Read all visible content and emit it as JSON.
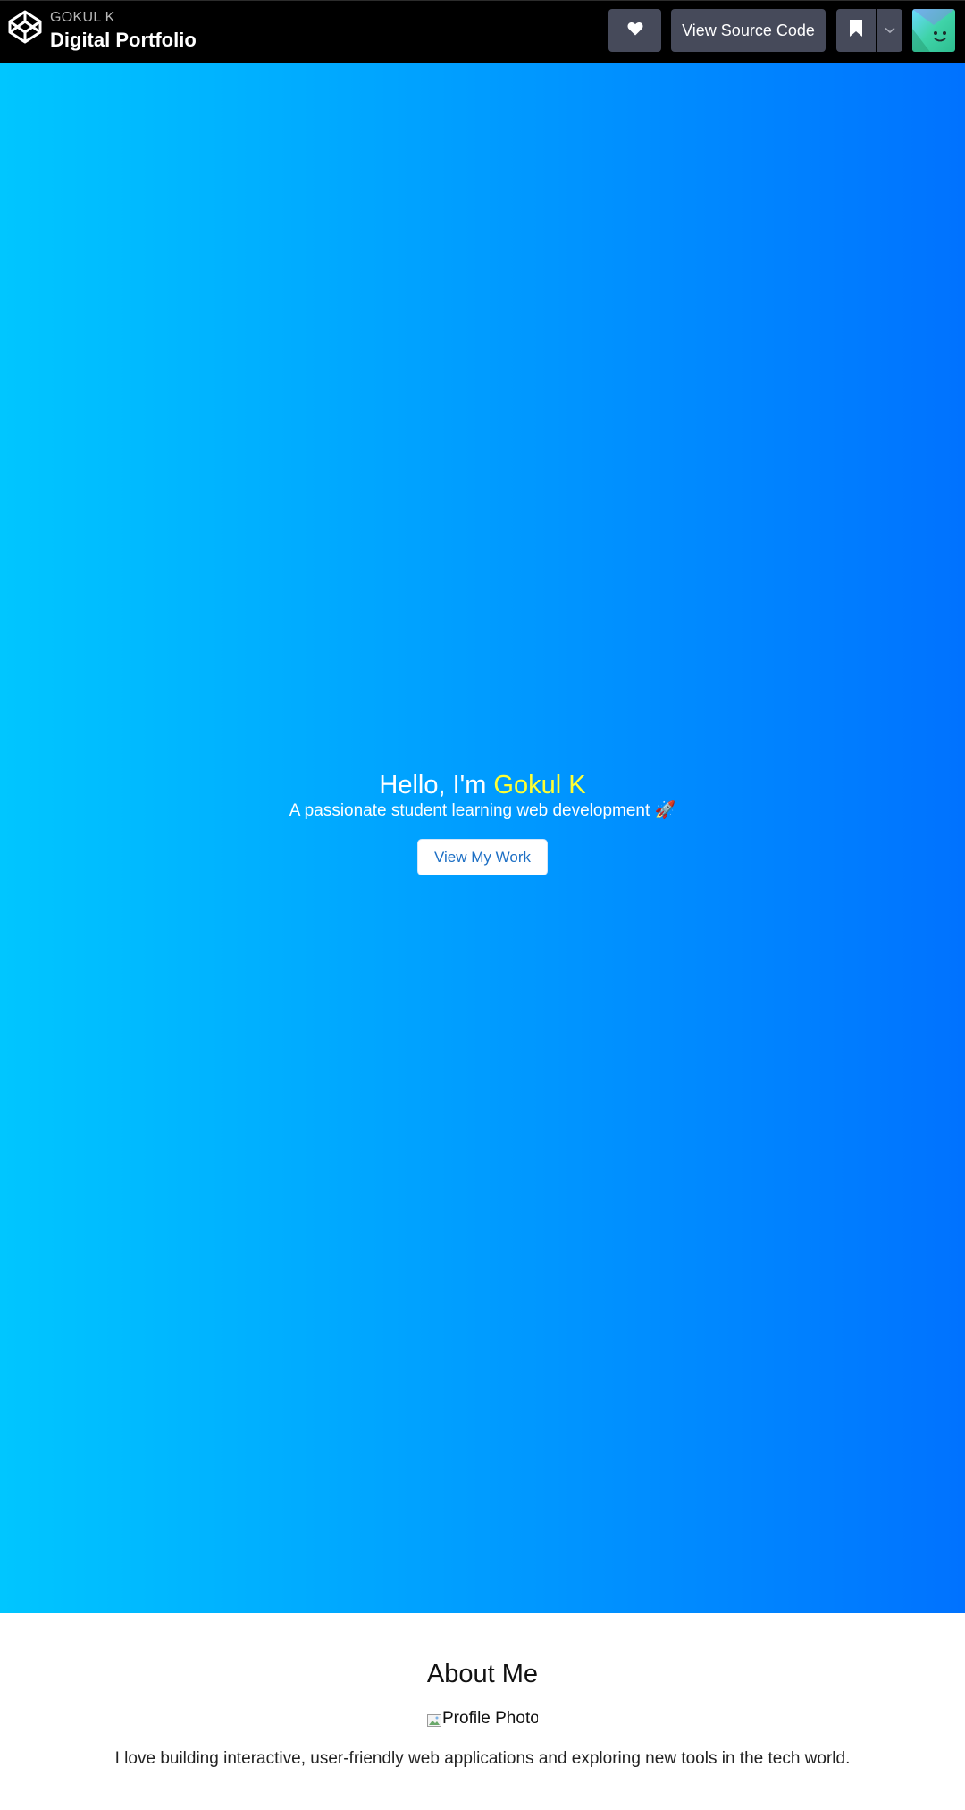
{
  "header": {
    "owner": "GOKUL K",
    "title": "Digital Portfolio",
    "source_label": "View Source Code",
    "icons": {
      "logo": "codepen-logo-icon",
      "like": "heart-icon",
      "save": "bookmark-icon",
      "menu": "chevron-down-icon",
      "avatar": "user-avatar"
    }
  },
  "hero": {
    "greeting": "Hello, I'm",
    "name": "Gokul K",
    "subtitle": "A passionate student learning web development 🚀",
    "button_label": "View My Work",
    "gradient": [
      "#00c6ff",
      "#0072ff"
    ],
    "name_color": "#ffff33"
  },
  "about": {
    "title": "About Me",
    "photo_alt": "Profile Photo",
    "text": "I love building interactive, user-friendly web applications and exploring new tools in the tech world."
  }
}
